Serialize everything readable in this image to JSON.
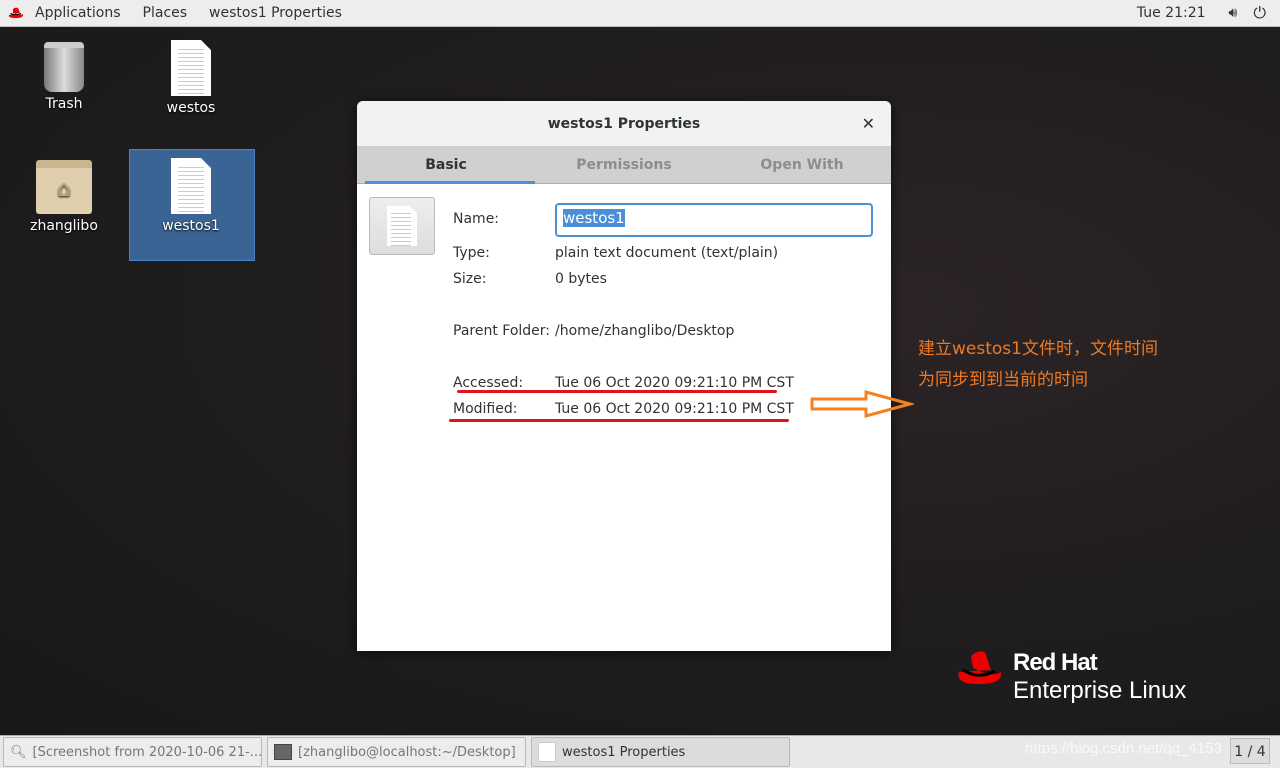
{
  "topbar": {
    "applications": "Applications",
    "places": "Places",
    "window_title": "westos1 Properties",
    "clock": "Tue 21:21",
    "volume_icon": "volume-icon",
    "power_icon": "power-icon"
  },
  "desktop": {
    "icons": [
      {
        "label": "Trash",
        "icon": "trash-icon"
      },
      {
        "label": "westos",
        "icon": "text-file-icon"
      },
      {
        "label": "zhanglibo",
        "icon": "home-folder-icon"
      },
      {
        "label": "westos1",
        "icon": "text-file-icon",
        "selected": true
      }
    ]
  },
  "dialog": {
    "title": "westos1 Properties",
    "tabs": [
      {
        "label": "Basic",
        "active": true
      },
      {
        "label": "Permissions"
      },
      {
        "label": "Open With"
      }
    ],
    "fields": {
      "name_label": "Name:",
      "name_value": "westos1",
      "type_label": "Type:",
      "type_value": "plain text document (text/plain)",
      "size_label": "Size:",
      "size_value": "0 bytes",
      "parent_label": "Parent Folder:",
      "parent_value": "/home/zhanglibo/Desktop",
      "accessed_label": "Accessed:",
      "accessed_value": "Tue 06 Oct 2020 09:21:10 PM CST",
      "modified_label": "Modified:",
      "modified_value": "Tue 06 Oct 2020 09:21:10 PM CST"
    }
  },
  "annotation": {
    "line1": "建立westos1文件时，文件时间",
    "line2": "为同步到到当前的时间",
    "color": "#f07a22",
    "underline_color": "#e2141b"
  },
  "brand": {
    "line1": "Red Hat",
    "line2": "Enterprise Linux"
  },
  "taskbar": {
    "items": [
      {
        "label": "[Screenshot from 2020-10-06 21-..."
      },
      {
        "label": "[zhanglibo@localhost:~/Desktop]"
      },
      {
        "label": "westos1 Properties",
        "active": true
      }
    ],
    "workspace": "1 / 4"
  },
  "watermark": "https://blog.csdn.net/qq_4153"
}
